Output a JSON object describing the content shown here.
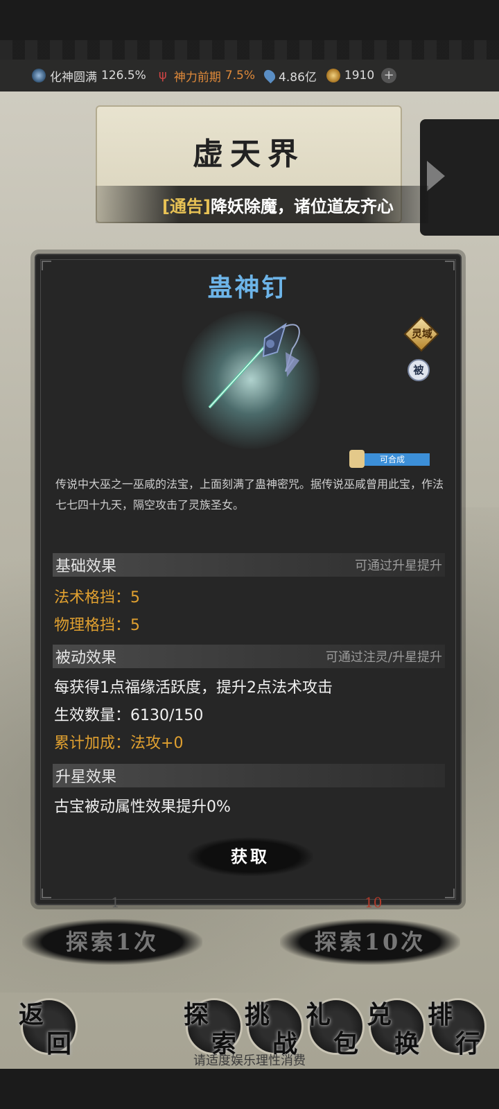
{
  "status": {
    "cultivation_label": "化神圆满",
    "cultivation_pct": "126.5%",
    "divine_label": "神力前期",
    "divine_pct": "7.5%",
    "spirit_stones": "4.86亿",
    "jade": "1910"
  },
  "realm": {
    "title": "虚天界"
  },
  "notice": {
    "tag": "[通告]",
    "text": "降妖除魔，诸位道友齐心"
  },
  "item": {
    "name": "蛊神钉",
    "badge_domain": "灵域",
    "badge_passive": "被",
    "craft_tag": "可合成",
    "description": "传说中大巫之一巫咸的法宝，上面刻满了蛊神密咒。据传说巫咸曾用此宝，作法七七四十九天，隔空攻击了灵族圣女。",
    "basic_effect": {
      "title": "基础效果",
      "hint": "可通过升星提升",
      "lines": [
        "法术格挡：5",
        "物理格挡：5"
      ]
    },
    "passive_effect": {
      "title": "被动效果",
      "hint": "可通过注灵/升星提升",
      "line1": "每获得1点福缘活跃度，提升2点法术攻击",
      "count_label": "生效数量：",
      "count_value": "6130/150",
      "accum_label": "累计加成：",
      "accum_value": "法攻+0"
    },
    "star_effect": {
      "title": "升星效果",
      "line": "古宝被动属性效果提升0%"
    },
    "get_button": "获取"
  },
  "explore": {
    "cost_1": "1",
    "cost_10": "10",
    "btn_1": "探索1次",
    "btn_10": "探索10次"
  },
  "nav": {
    "back": [
      "返",
      "回"
    ],
    "explore": [
      "探",
      "索"
    ],
    "challenge": [
      "挑",
      "战"
    ],
    "gift": [
      "礼",
      "包"
    ],
    "exchange": [
      "兑",
      "换"
    ],
    "rank": [
      "排",
      "行"
    ]
  },
  "footer_note": "请适度娱乐理性消费"
}
